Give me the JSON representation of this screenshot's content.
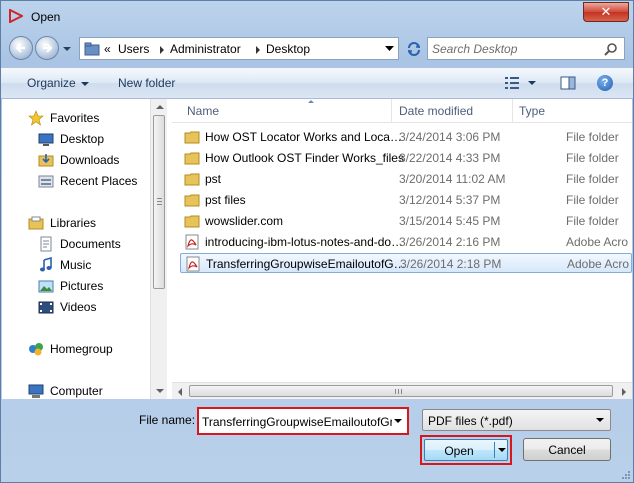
{
  "window": {
    "title": "Open",
    "close_label": "✕"
  },
  "nav": {
    "breadcrumb": [
      "«",
      "Users",
      "Administrator",
      "Desktop"
    ],
    "search_placeholder": "Search Desktop"
  },
  "toolbar": {
    "organize_label": "Organize",
    "new_folder_label": "New folder",
    "help_label": "?"
  },
  "sidebar": {
    "favorites": "Favorites",
    "favorite_items": [
      "Desktop",
      "Downloads",
      "Recent Places"
    ],
    "libraries": "Libraries",
    "library_items": [
      "Documents",
      "Music",
      "Pictures",
      "Videos"
    ],
    "homegroup": "Homegroup",
    "computer": "Computer"
  },
  "columns": {
    "name": "Name",
    "date_modified": "Date modified",
    "type": "Type"
  },
  "files": [
    {
      "name": "How OST Locator Works and Locates All ...",
      "date": "3/24/2014 3:06 PM",
      "type": "File folder",
      "icon": "folder-icon"
    },
    {
      "name": "How Outlook OST Finder Works_files",
      "date": "3/22/2014 4:33 PM",
      "type": "File folder",
      "icon": "folder-icon"
    },
    {
      "name": "pst",
      "date": "3/20/2014 11:02 AM",
      "type": "File folder",
      "icon": "folder-icon"
    },
    {
      "name": "pst files",
      "date": "3/12/2014 5:37 PM",
      "type": "File folder",
      "icon": "folder-icon"
    },
    {
      "name": "wowslider.com",
      "date": "3/15/2014 5:45 PM",
      "type": "File folder",
      "icon": "folder-icon"
    },
    {
      "name": "introducing-ibm-lotus-notes-and-domi...",
      "date": "3/26/2014 2:16 PM",
      "type": "Adobe Acro",
      "icon": "pdf-icon"
    },
    {
      "name": "TransferringGroupwiseEmailoutofGroup...",
      "date": "3/26/2014 2:18 PM",
      "type": "Adobe Acro",
      "icon": "pdf-icon",
      "selected": true
    }
  ],
  "bottom": {
    "filename_label": "File name:",
    "filename_value": "TransferringGroupwiseEmailoutofGroupwise",
    "filetype_value": "PDF files (*.pdf)",
    "open_label": "Open",
    "cancel_label": "Cancel"
  },
  "colors": {
    "highlight_border": "#d8171d",
    "selection_border": "#84acdd",
    "folder": "#e8c35a"
  }
}
